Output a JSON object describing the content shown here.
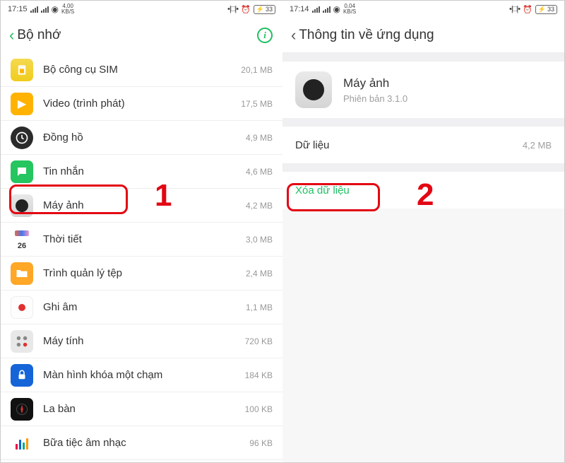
{
  "left": {
    "status": {
      "time": "17:15",
      "speed": "4,00\nKB/S",
      "battery": "33"
    },
    "header": {
      "title": "Bộ nhớ"
    },
    "apps": [
      {
        "name": "Bộ công cụ SIM",
        "size": "20,1 MB",
        "icon": "sim"
      },
      {
        "name": "Video (trình phát)",
        "size": "17,5 MB",
        "icon": "video"
      },
      {
        "name": "Đồng hồ",
        "size": "4,9 MB",
        "icon": "clock"
      },
      {
        "name": "Tin nhắn",
        "size": "4,6 MB",
        "icon": "msg"
      },
      {
        "name": "Máy ảnh",
        "size": "4,2 MB",
        "icon": "camera"
      },
      {
        "name": "Thời tiết",
        "size": "3,0 MB",
        "icon": "weather"
      },
      {
        "name": "Trình quản lý tệp",
        "size": "2,4 MB",
        "icon": "folder"
      },
      {
        "name": "Ghi âm",
        "size": "1,1 MB",
        "icon": "rec"
      },
      {
        "name": "Máy tính",
        "size": "720 KB",
        "icon": "calc"
      },
      {
        "name": "Màn hình khóa một chạm",
        "size": "184 KB",
        "icon": "lock"
      },
      {
        "name": "La bàn",
        "size": "100 KB",
        "icon": "compass"
      },
      {
        "name": "Bữa tiệc âm nhạc",
        "size": "96 KB",
        "icon": "music"
      }
    ],
    "step": "1"
  },
  "right": {
    "status": {
      "time": "17:14",
      "speed": "0,04\nKB/S",
      "battery": "33"
    },
    "header": {
      "title": "Thông tin về ứng dụng"
    },
    "app": {
      "name": "Máy ảnh",
      "version": "Phiên bản  3.1.0"
    },
    "data_label": "Dữ liệu",
    "data_value": "4,2 MB",
    "clear_label": "Xóa dữ liệu",
    "step": "2"
  },
  "weather_day": "26"
}
